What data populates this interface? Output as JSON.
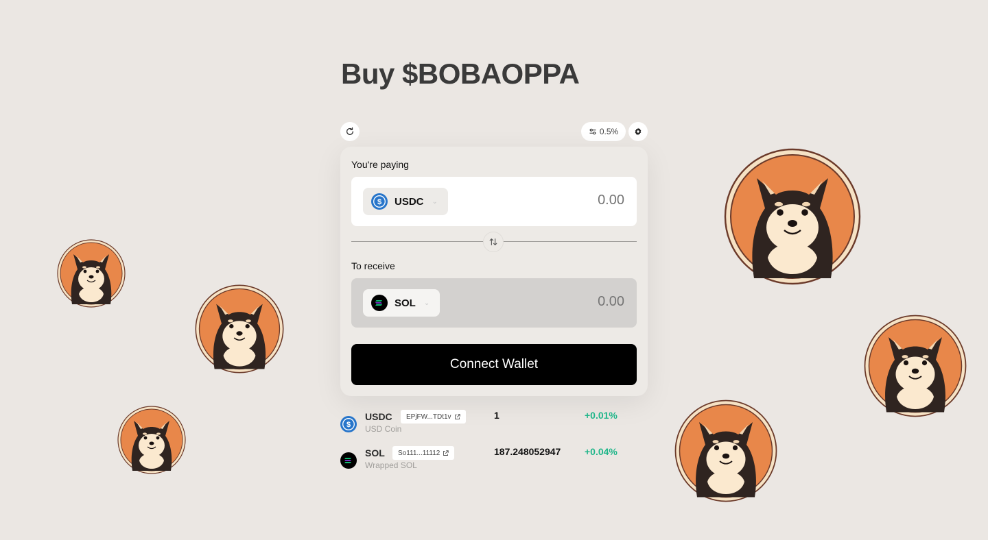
{
  "page": {
    "title": "Buy $BOBAOPPA"
  },
  "toolbar": {
    "slippage": "0.5%"
  },
  "swap": {
    "pay_label": "You're paying",
    "pay_token": "USDC",
    "pay_amount_placeholder": "0.00",
    "receive_label": "To receive",
    "receive_token": "SOL",
    "receive_amount_placeholder": "0.00",
    "connect_label": "Connect Wallet"
  },
  "tokens": [
    {
      "symbol": "USDC",
      "name": "USD Coin",
      "address": "EPjFW...TDt1v",
      "price": "1",
      "change": "+0.01%"
    },
    {
      "symbol": "SOL",
      "name": "Wrapped SOL",
      "address": "So111...11112",
      "price": "187.248052947",
      "change": "+0.04%"
    }
  ],
  "colors": {
    "accent": "#000000",
    "positive": "#20b68a",
    "coin_orange": "#e8874a",
    "background": "#ebe7e3"
  },
  "icons": [
    "refresh-icon",
    "sliders-icon",
    "gear-icon",
    "usdc-icon",
    "sol-icon",
    "swap-arrows-icon",
    "external-link-icon",
    "chevron-down-icon",
    "dog-coin-icon"
  ]
}
